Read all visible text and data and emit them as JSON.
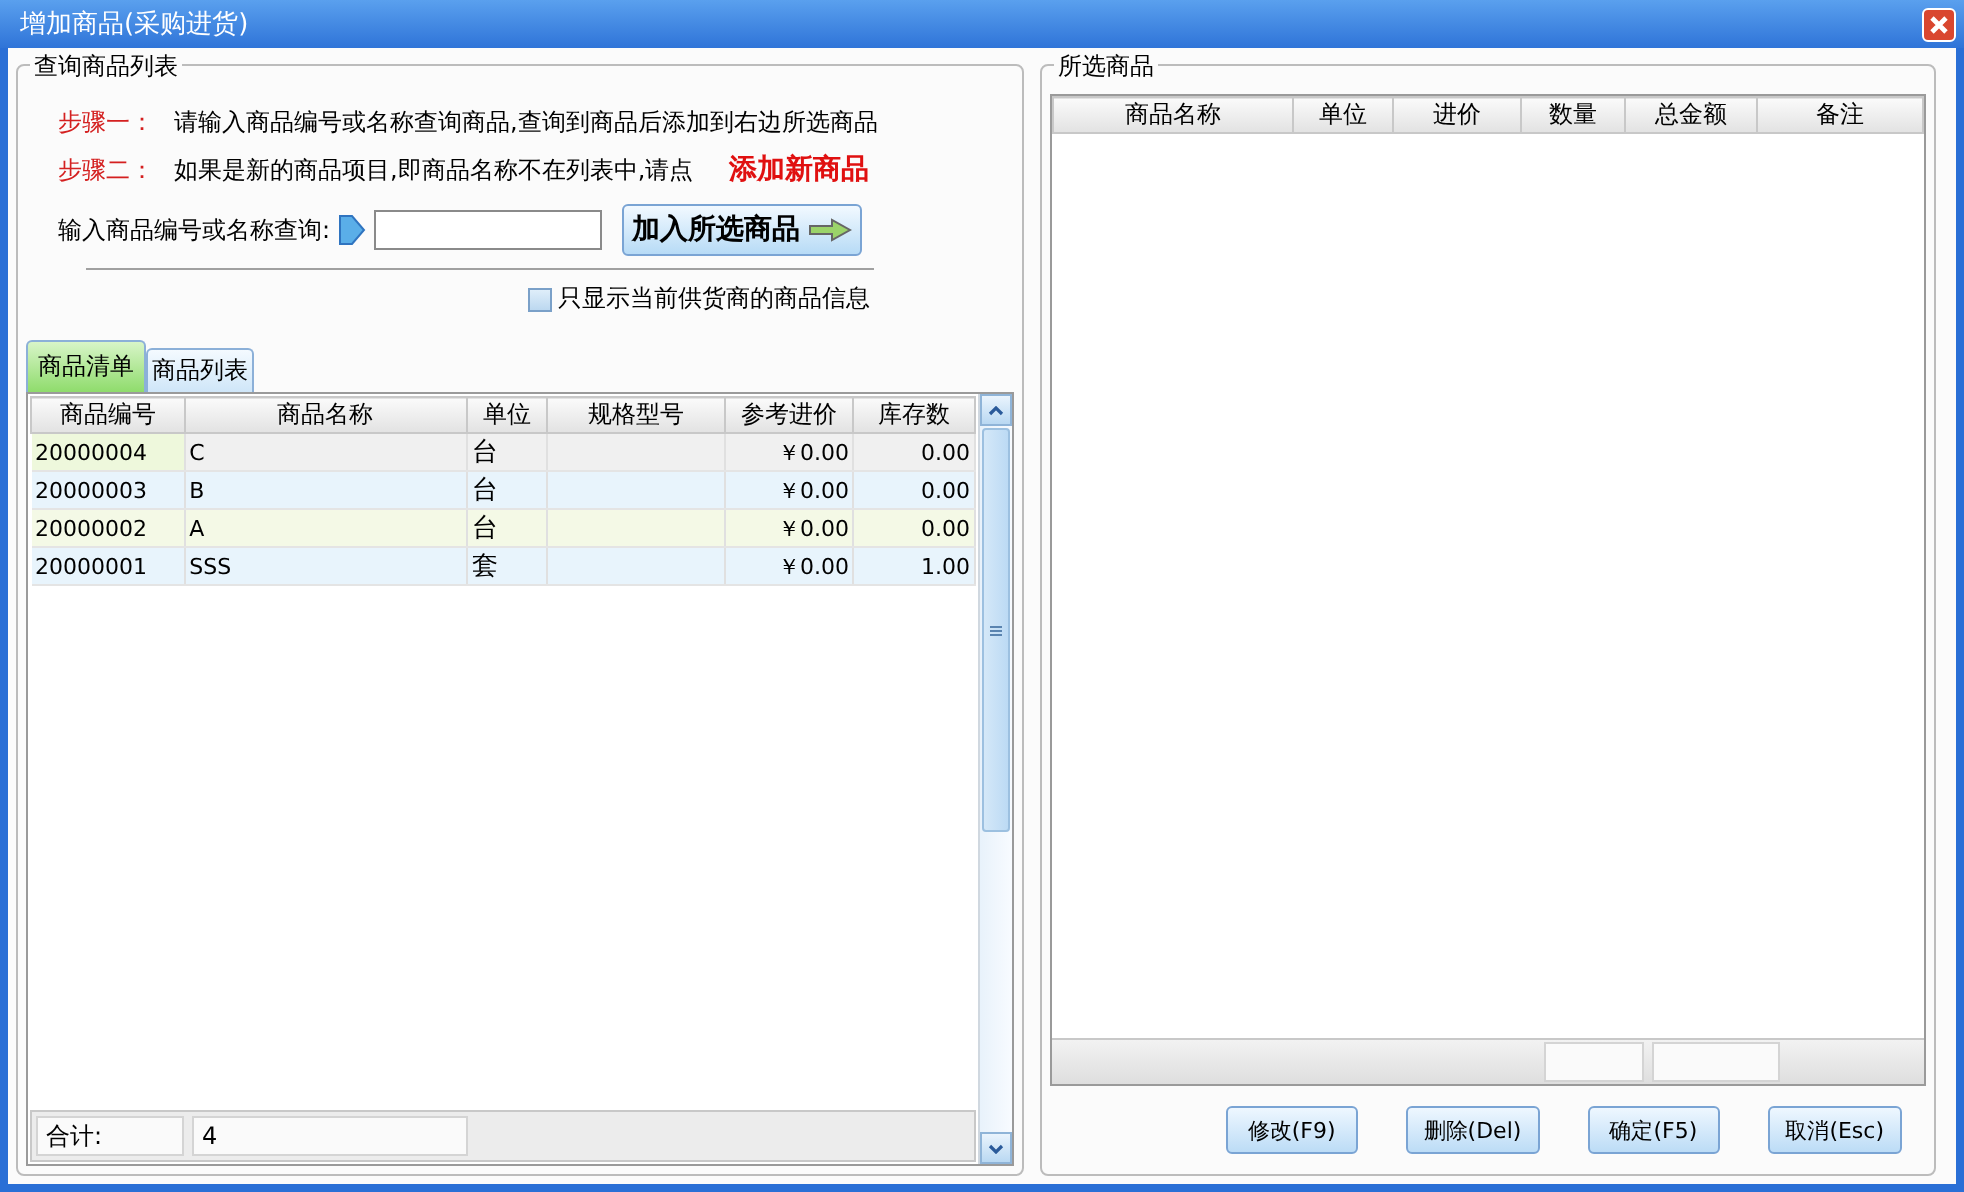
{
  "window": {
    "title": "增加商品(采购进货)"
  },
  "query_panel": {
    "title": "查询商品列表",
    "steps": [
      {
        "label": "步骤一：",
        "text": "请输入商品编号或名称查询商品,查询到商品后添加到右边所选商品"
      },
      {
        "label": "步骤二：",
        "text": "如果是新的商品项目,即商品名称不在列表中,请点",
        "link": "添加新商品"
      }
    ],
    "search": {
      "label": "输入商品编号或名称查询:"
    },
    "add_button": "加入所选商品",
    "supplier_filter": {
      "label": "只显示当前供货商的商品信息",
      "checked": false
    },
    "tabs": [
      {
        "label": "商品清单",
        "selected": true
      },
      {
        "label": "商品列表",
        "selected": false
      }
    ],
    "table": {
      "columns": [
        "商品编号",
        "商品名称",
        "单位",
        "规格型号",
        "参考进价",
        "库存数"
      ],
      "rows": [
        [
          "20000004",
          "C",
          "台",
          "",
          "￥0.00",
          "0.00"
        ],
        [
          "20000003",
          "B",
          "台",
          "",
          "￥0.00",
          "0.00"
        ],
        [
          "20000002",
          "A",
          "台",
          "",
          "￥0.00",
          "0.00"
        ],
        [
          "20000001",
          "SSS",
          "套",
          "",
          "￥0.00",
          "1.00"
        ]
      ],
      "footer": {
        "label": "合计:",
        "count": "4"
      }
    }
  },
  "selected_panel": {
    "title": "所选商品",
    "columns": [
      "商品名称",
      "单位",
      "进价",
      "数量",
      "总金额",
      "备注"
    ]
  },
  "buttons": [
    "修改(F9)",
    "删除(Del)",
    "确定(F5)",
    "取消(Esc)"
  ]
}
